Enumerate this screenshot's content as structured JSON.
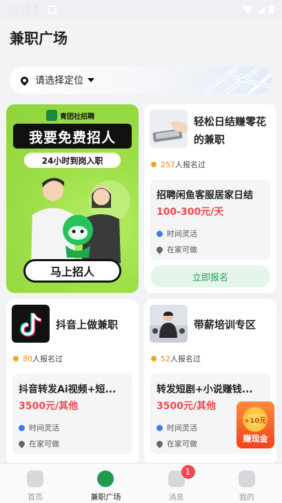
{
  "status_bar": {
    "time": "11:33"
  },
  "page": {
    "title": "兼职广场"
  },
  "location": {
    "label": "请选择定位"
  },
  "promo": {
    "brand": "青团社招聘",
    "headline": "我要免费招人",
    "subline": "24小时到岗入职",
    "cta": "马上招人"
  },
  "cards": [
    {
      "title_line1": "轻松日结赚零花",
      "title_line2": "的兼职",
      "signup_count": "257",
      "signup_suffix": "人报名过",
      "job_title": "招聘闲鱼客服居家日结",
      "salary": "100-300元/天",
      "meta_time": "时间灵活",
      "meta_place": "在家可做",
      "apply_label": "立即报名"
    },
    {
      "title_line1": "抖音上做兼职",
      "signup_count": "80",
      "signup_suffix": "人报名过",
      "job_title": "抖音转发Ai视频+短...",
      "salary": "3500元/其他",
      "meta_time": "时间灵活",
      "meta_place": "在家可做"
    },
    {
      "title_line1": "带薪培训专区",
      "signup_count": "52",
      "signup_suffix": "人报名过",
      "job_title": "转发短剧+小说赚钱...",
      "salary": "3500元/其他",
      "meta_time": "时间灵活",
      "meta_place": "在家可做"
    }
  ],
  "float_badge": {
    "amount": "+10元",
    "label": "赚现金"
  },
  "tabbar": {
    "tabs": [
      {
        "label": "首页"
      },
      {
        "label": "兼职广场"
      },
      {
        "label": "消息",
        "badge": "1"
      },
      {
        "label": "我的"
      }
    ]
  },
  "colors": {
    "accent": "#1f9a4f",
    "salary": "#f0484d",
    "promo_bg": "#9fe04a"
  }
}
